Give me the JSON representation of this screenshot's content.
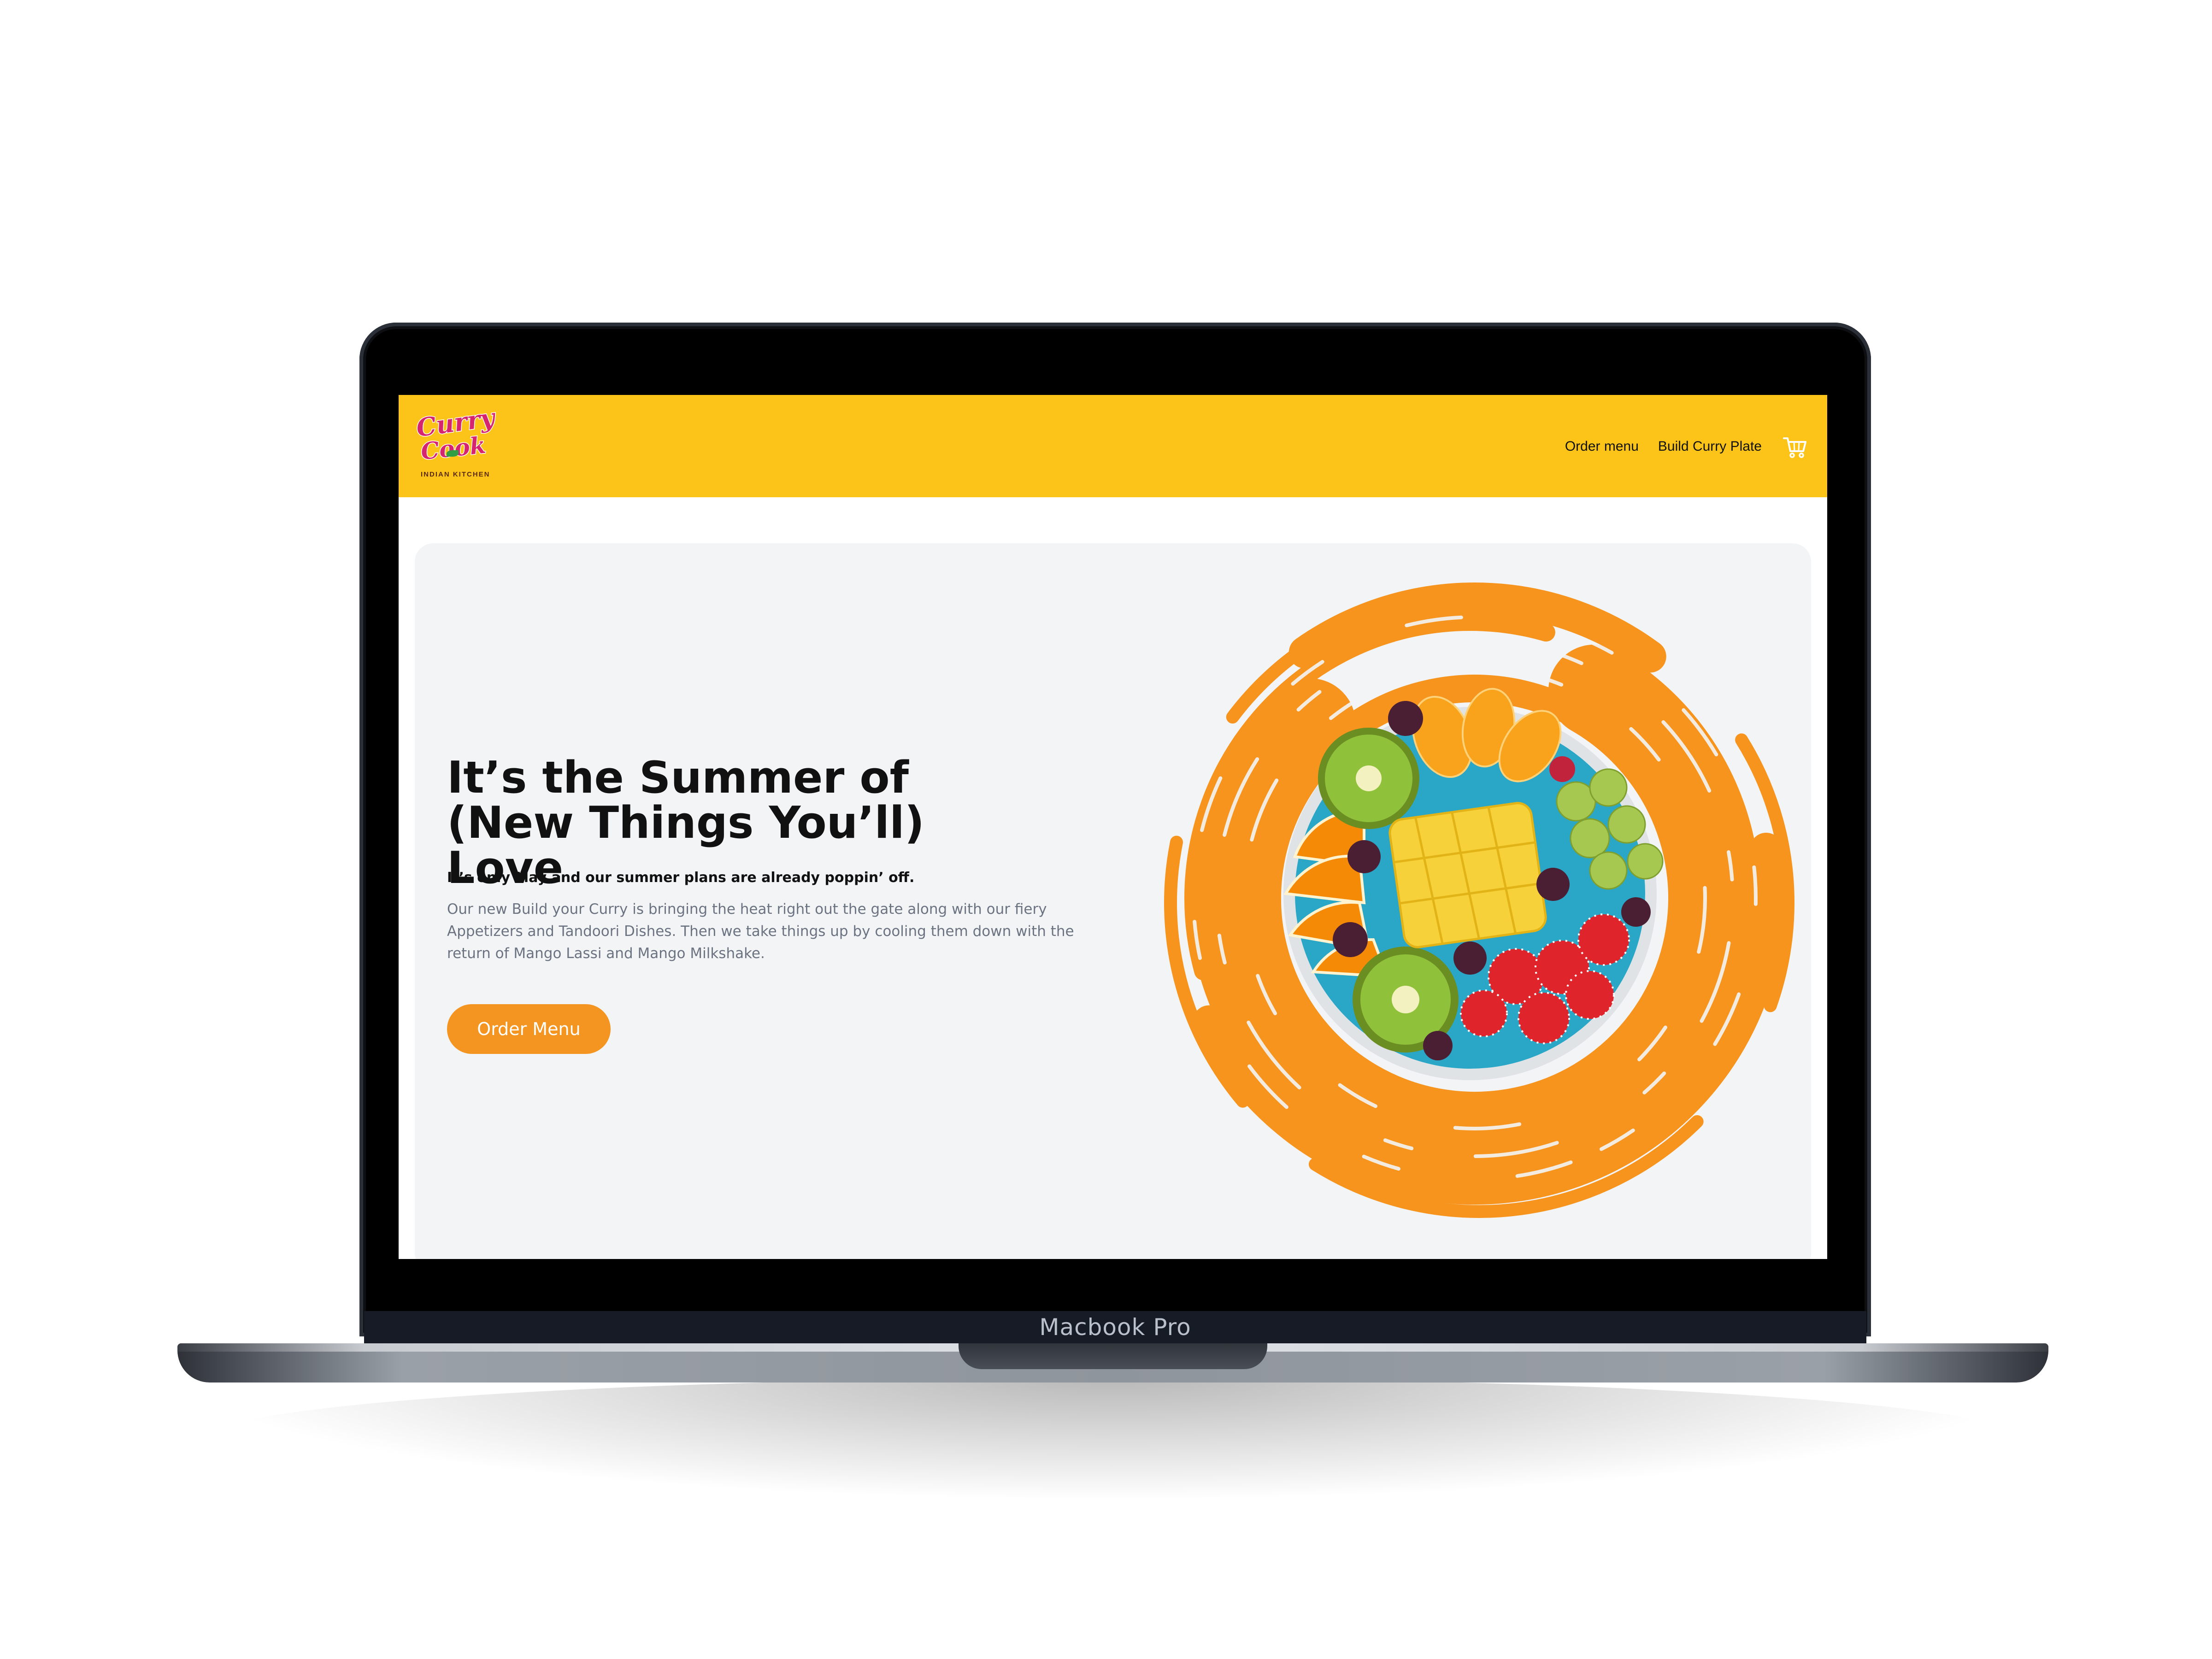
{
  "device": {
    "label": "Macbook Pro"
  },
  "site": {
    "logo": {
      "word1": "Curry",
      "word2": "Cook",
      "tagline": "INDIAN KITCHEN"
    },
    "nav": {
      "items": [
        {
          "label": "Order menu"
        },
        {
          "label": "Build Curry Plate"
        }
      ],
      "cart_icon": "shopping-cart-icon"
    },
    "hero": {
      "title": "It’s the Summer of (New Things You’ll) Love",
      "lead": "It’s only May and our summer plans are already poppin’ off.",
      "body": "Our new Build your Curry is bringing the heat right out the gate along with our fiery Appetizers and Tandoori Dishes. Then we take things up by cooling them down with the return of Mango Lassi and Mango Milkshake.",
      "cta_label": "Order Menu",
      "image": "fruit-bowl-on-orange-brush-swirl"
    }
  },
  "colors": {
    "header": "#fcc419",
    "accent": "#f59521",
    "hero_bg": "#f3f4f6",
    "logo": "#d6246e"
  }
}
